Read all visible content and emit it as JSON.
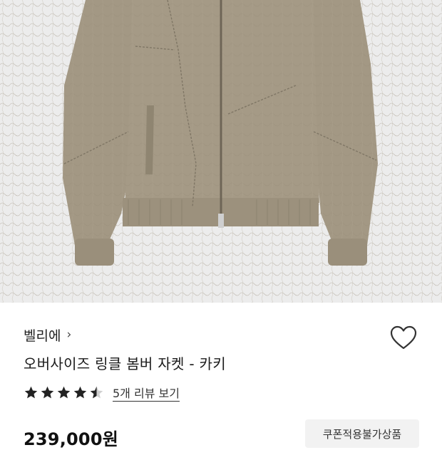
{
  "product": {
    "image_alt": "khaki oversized wrinkle bomber jacket",
    "brand": "벨리에",
    "brand_chevron": "›",
    "title": "오버사이즈 링클 봄버 자켓 - 카키",
    "rating": 4.5,
    "review_link": "5개 리뷰 보기",
    "price": "239,000원",
    "coupon_badge": "쿠폰적용불가상품"
  },
  "icons": {
    "wishlist": "heart-outline-icon",
    "star": "star-icon",
    "brand_arrow": "chevron-right-icon"
  },
  "colors": {
    "image_bg": "#ececec",
    "jacket": "#a59a86",
    "star": "#222222",
    "coupon_bg": "#f2f2f2"
  }
}
